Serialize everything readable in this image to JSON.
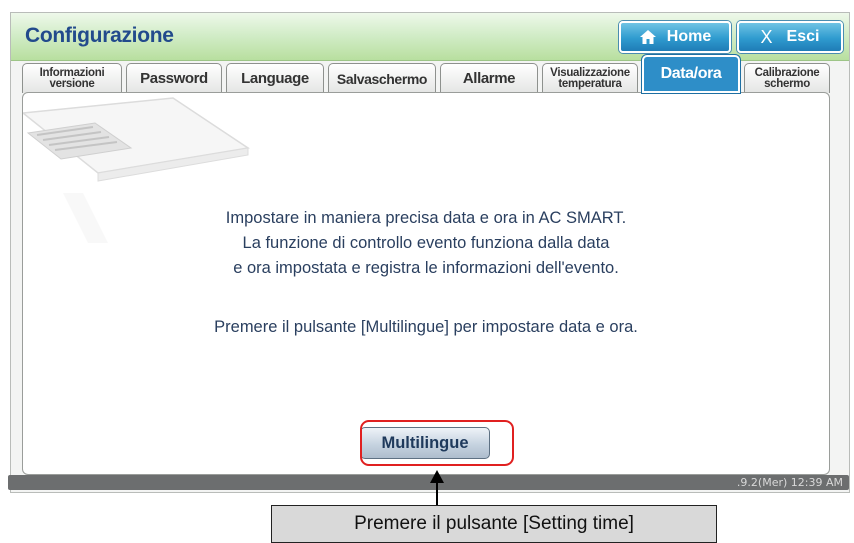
{
  "window": {
    "title": "Configurazione"
  },
  "header": {
    "home_label": "Home",
    "exit_label": "Esci",
    "exit_icon": "X"
  },
  "tabs": [
    {
      "line1": "Informazioni",
      "line2": "versione"
    },
    {
      "label": "Password"
    },
    {
      "label": "Language"
    },
    {
      "label": "Salvaschermo"
    },
    {
      "label": "Allarme"
    },
    {
      "line1": "Visualizzazione",
      "line2": "temperatura"
    },
    {
      "label": "Data/ora",
      "active": true
    },
    {
      "line1": "Calibrazione",
      "line2": "schermo"
    }
  ],
  "content": {
    "paragraph": [
      "Impostare in maniera precisa data e ora in AC SMART.",
      "La funzione di controllo evento funziona dalla data",
      "e ora impostata e registra le informazioni dell'evento."
    ],
    "instruction": "Premere il pulsante [Multilingue] per impostare data e ora.",
    "button_label": "Multilingue"
  },
  "statusbar": {
    "datetime": ".9.2(Mer) 12:39 AM"
  },
  "callout": {
    "text": "Premere il pulsante [Setting time]"
  },
  "colors": {
    "accent": "#2e8ec8",
    "title": "#224a8c",
    "highlight": "#e02020"
  },
  "icons": {
    "home": "home-icon",
    "close": "close-icon"
  }
}
